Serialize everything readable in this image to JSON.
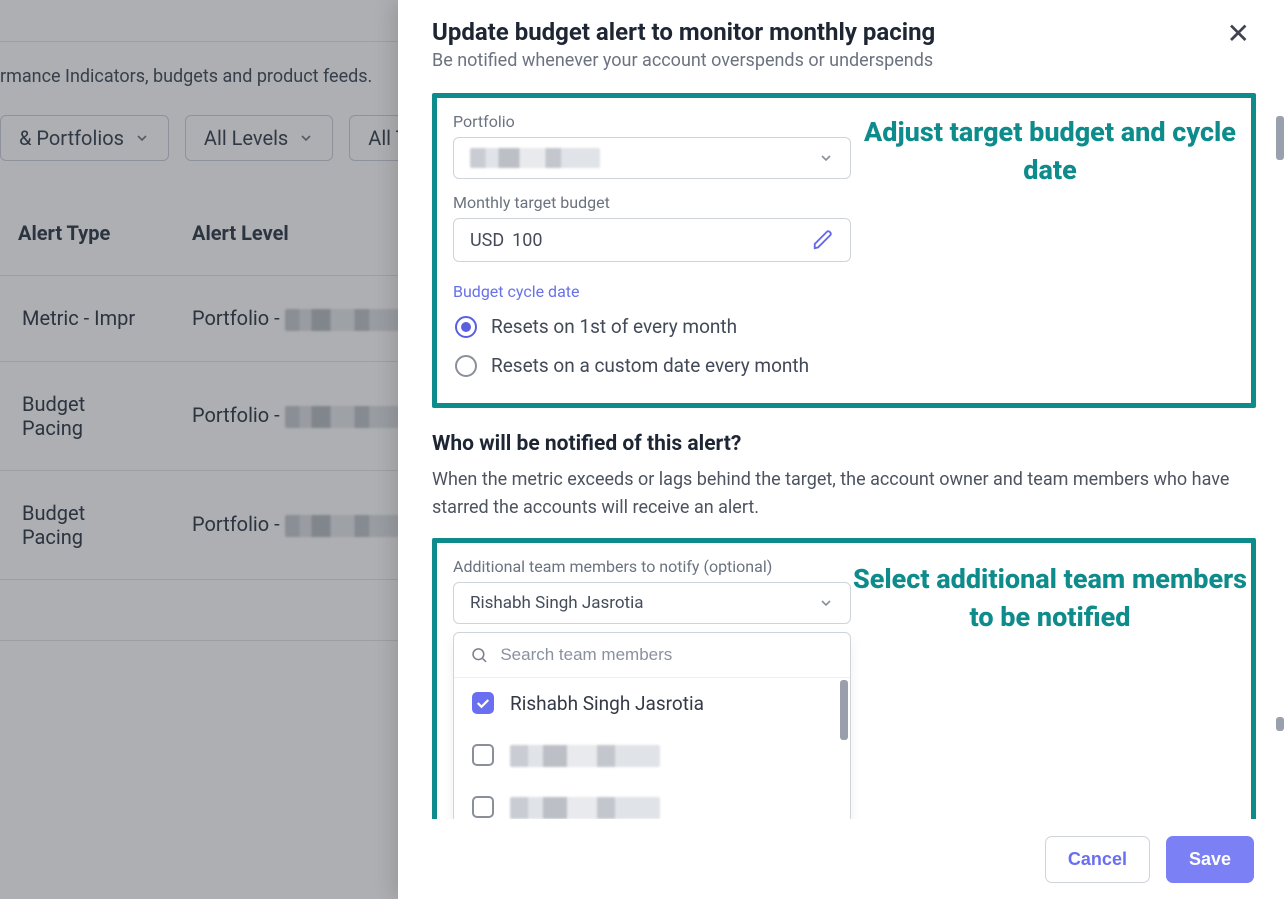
{
  "background": {
    "description_fragment": "rmance Indicators, budgets and product feeds.",
    "filters": {
      "portfolios": "& Portfolios",
      "levels": "All Levels",
      "types_fragment": "All T"
    },
    "table": {
      "headers": {
        "alert_type": "Alert Type",
        "alert_level": "Alert Level"
      },
      "rows": [
        {
          "type": "Metric - Impr",
          "level_prefix": "Portfolio -"
        },
        {
          "type": "Budget Pacing",
          "level_prefix": "Portfolio -"
        },
        {
          "type": "Budget Pacing",
          "level_prefix": "Portfolio -"
        },
        {
          "type": " ",
          "level_prefix": " "
        }
      ]
    }
  },
  "drawer": {
    "title": "Update budget alert to monitor monthly pacing",
    "subtitle": "Be notified whenever your account overspends or underspends",
    "portfolio_label": "Portfolio",
    "budget_label": "Monthly target budget",
    "budget_currency": "USD",
    "budget_value": "100",
    "cycle_label": "Budget cycle date",
    "cycle_options": {
      "first": "Resets on 1st of every month",
      "custom": "Resets on a custom date every month"
    },
    "callout1": "Adjust target budget and cycle date",
    "notify_h2": "Who will be notified of this alert?",
    "notify_p": "When the metric exceeds or lags behind the target, the account owner and team members who have starred the accounts will receive an alert.",
    "team_label": "Additional team members to notify (optional)",
    "team_selected": "Rishabh Singh Jasrotia",
    "search_placeholder": "Search team members",
    "team_options": [
      {
        "name": "Rishabh Singh Jasrotia",
        "checked": true
      },
      {
        "name": "████████",
        "checked": false
      },
      {
        "name": "████████",
        "checked": false
      }
    ],
    "callout2": "Select additional team members to be notified",
    "cancel": "Cancel",
    "save": "Save"
  }
}
